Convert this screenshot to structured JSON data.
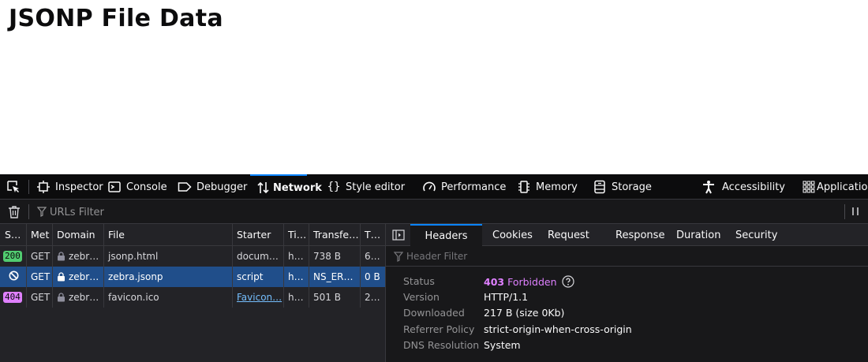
{
  "page": {
    "title": "JSONP File Data"
  },
  "toolbar": {
    "tabs": [
      {
        "label": "Inspector",
        "icon": "inspector-icon"
      },
      {
        "label": "Console",
        "icon": "console-icon"
      },
      {
        "label": "Debugger",
        "icon": "debugger-icon"
      },
      {
        "label": "Network",
        "icon": "network-icon",
        "selected": true
      },
      {
        "label": "Style editor",
        "icon": "style-editor-icon"
      },
      {
        "label": "Performance",
        "icon": "performance-icon"
      },
      {
        "label": "Memory",
        "icon": "memory-icon"
      },
      {
        "label": "Storage",
        "icon": "storage-icon"
      },
      {
        "label": "Accessibility",
        "icon": "accessibility-icon"
      },
      {
        "label": "Application",
        "icon": "application-icon"
      }
    ]
  },
  "filter": {
    "placeholder": "URLs Filter"
  },
  "requests": {
    "columns": [
      "S…",
      "Met",
      "Domain",
      "File",
      "Starter",
      "Ti…",
      "Transfe…",
      "T…"
    ],
    "rows": [
      {
        "status": "200",
        "method": "GET",
        "domain": "zebr…",
        "file": "jsonp.html",
        "starter": "docum…",
        "time": "h…",
        "transferred": "738 B",
        "size": "6…"
      },
      {
        "status": "",
        "method": "GET",
        "domain": "zebr…",
        "file": "zebra.jsonp",
        "starter": "script",
        "time": "h…",
        "transferred": "NS_ER…",
        "size": "0 B",
        "selected": true
      },
      {
        "status": "404",
        "method": "GET",
        "domain": "zebr…",
        "file": "favicon.ico",
        "starter": "Favicon…",
        "time": "h…",
        "transferred": "501 B",
        "size": "2…"
      }
    ]
  },
  "details": {
    "tabs": [
      "Headers",
      "Cookies",
      "Request",
      "Response",
      "Duration",
      "Security"
    ],
    "selected_tab": "Headers",
    "header_filter_placeholder": "Header Filter",
    "summary": {
      "status_label": "Status",
      "status_code": "403",
      "status_text": "Forbidden",
      "version_label": "Version",
      "version": "HTTP/1.1",
      "downloaded_label": "Downloaded",
      "downloaded": "217 B (size 0Kb)",
      "referrer_label": "Referrer Policy",
      "referrer": "strict-origin-when-cross-origin",
      "dns_label": "DNS Resolution",
      "dns": "System"
    }
  },
  "colors": {
    "accent": "#0a84ff",
    "selected_row": "#204e8a",
    "status_ok": "#51cc70",
    "status_error": "#df80ff"
  }
}
